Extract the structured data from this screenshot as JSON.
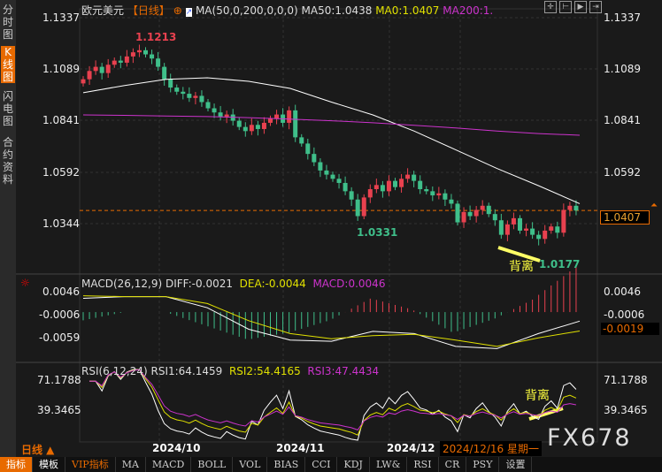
{
  "sidebar": [
    "分时图",
    "K线图",
    "闪电图",
    "合约资料"
  ],
  "header": {
    "symbol": "欧元美元",
    "period": "【日线】",
    "ma_label": "MA(50,0,200,0,0,0)",
    "ma50": "MA50:1.0438",
    "ma0": "MA0:1.0407",
    "ma200": "MA200:1."
  },
  "price_axis": {
    "left": [
      "1.1337",
      "1.1089",
      "1.0841",
      "1.0592",
      "1.0344"
    ],
    "right": [
      "1.1337",
      "1.1089",
      "1.0841",
      "1.0592"
    ],
    "current": "1.0407"
  },
  "annotations": {
    "high": "1.1213",
    "low1": "1.0331",
    "low2": "1.0177",
    "divergence": "背离",
    "divergence2": "背离"
  },
  "macd": {
    "label": "MACD(26,12,9)",
    "diff": "DIFF:-0.0021",
    "dea": "DEA:-0.0044",
    "macd": "MACD:0.0046",
    "axis": [
      "0.0046",
      "-0.0006",
      "-0.0059"
    ],
    "current": "-0.0019"
  },
  "rsi": {
    "label": "RSI(6,12,24)",
    "rsi1": "RSI1:64.1459",
    "rsi2": "RSI2:54.4165",
    "rsi3": "RSI3:47.4434",
    "axis": [
      "71.1788",
      "39.3465"
    ]
  },
  "dates": {
    "period": "日线 ▲",
    "ticks": [
      "2024/10",
      "2024/11",
      "2024/12"
    ],
    "cursor": "2024/12/16 星期一"
  },
  "watermark": "FX678",
  "toolbar": [
    "指标",
    "模板",
    "VIP指标",
    "MA",
    "MACD",
    "BOLL",
    "VOL",
    "BIAS",
    "CCI",
    "KDJ",
    "LW&",
    "RSI",
    "CR",
    "PSY",
    "设置"
  ],
  "colors": {
    "up": "#e8414f",
    "down": "#3fbf8a",
    "ma50": "#ffffff",
    "ma200": "#cc33cc",
    "dea": "#e0e000",
    "accent": "#e86a00"
  },
  "candles_close": [
    1.104,
    1.108,
    1.11,
    1.107,
    1.111,
    1.113,
    1.112,
    1.115,
    1.117,
    1.118,
    1.116,
    1.114,
    1.11,
    1.104,
    1.1,
    1.098,
    1.097,
    1.095,
    1.096,
    1.093,
    1.09,
    1.088,
    1.086,
    1.087,
    1.084,
    1.081,
    1.079,
    1.082,
    1.08,
    1.083,
    1.085,
    1.087,
    1.083,
    1.089,
    1.076,
    1.073,
    1.068,
    1.064,
    1.06,
    1.058,
    1.056,
    1.054,
    1.05,
    1.046,
    1.038,
    1.047,
    1.051,
    1.053,
    1.05,
    1.055,
    1.052,
    1.056,
    1.058,
    1.055,
    1.051,
    1.05,
    1.048,
    1.049,
    1.046,
    1.044,
    1.035,
    1.04,
    1.038,
    1.041,
    1.043,
    1.039,
    1.036,
    1.029,
    1.034,
    1.037,
    1.031,
    1.032,
    1.029,
    1.027,
    1.031,
    1.033,
    1.03,
    1.041,
    1.043,
    1.0407
  ],
  "ma50_path": [
    1.0975,
    1.101,
    1.104,
    1.1047,
    1.103,
    1.0996,
    1.093,
    1.0868,
    1.079,
    1.07,
    1.061,
    1.0527,
    1.044
  ],
  "ma200_path": [
    1.0868,
    1.0866,
    1.0863,
    1.086,
    1.0855,
    1.0848,
    1.084,
    1.083,
    1.0818,
    1.0805,
    1.079,
    1.0778,
    1.077
  ],
  "diff_path": [
    0.0032,
    0.0036,
    0.0036,
    0.001,
    -0.004,
    -0.0065,
    -0.0068,
    -0.0045,
    -0.005,
    -0.008,
    -0.0085,
    -0.005,
    -0.0021
  ],
  "dea_path": [
    0.0038,
    0.0036,
    0.0036,
    0.002,
    -0.002,
    -0.005,
    -0.0062,
    -0.0055,
    -0.0052,
    -0.0065,
    -0.008,
    -0.006,
    -0.0044
  ]
}
